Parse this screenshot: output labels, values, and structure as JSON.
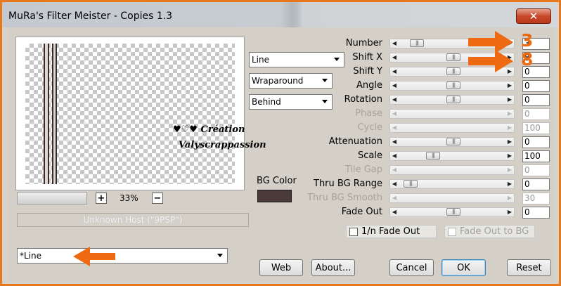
{
  "window": {
    "title": "MuRa's Filter Meister - Copies 1.3",
    "close_glyph": "✕"
  },
  "preview": {
    "zoom_value": "33%",
    "zoom_plus": "+",
    "zoom_minus": "−",
    "host_text": "Unknown Host (\"9PSP\")",
    "watermark_line1": "♥♡♥ Création",
    "watermark_line2": "Valyscrappassion"
  },
  "dropdowns": {
    "copy_mode": "Line",
    "edge_mode": "Wraparound",
    "blend_order": "Behind",
    "preset": "*Line"
  },
  "bg_color": {
    "label": "BG Color",
    "value": "#4a3b38"
  },
  "params": [
    {
      "label": "Number",
      "value": "3",
      "enabled": true,
      "level": 0.12
    },
    {
      "label": "Shift X",
      "value": "8",
      "enabled": true,
      "level": 0.5
    },
    {
      "label": "Shift Y",
      "value": "0",
      "enabled": true,
      "level": 0.5
    },
    {
      "label": "Angle",
      "value": "0",
      "enabled": true,
      "level": 0.5
    },
    {
      "label": "Rotation",
      "value": "0",
      "enabled": true,
      "level": 0.5
    },
    {
      "label": "Phase",
      "value": "0",
      "enabled": false,
      "level": 0
    },
    {
      "label": "Cycle",
      "value": "100",
      "enabled": false,
      "level": 0
    },
    {
      "label": "Attenuation",
      "value": "0",
      "enabled": true,
      "level": 0.5
    },
    {
      "label": "Scale",
      "value": "100",
      "enabled": true,
      "level": 0.29
    },
    {
      "label": "Tile Gap",
      "value": "0",
      "enabled": false,
      "level": 0
    },
    {
      "label": "Thru BG Range",
      "value": "0",
      "enabled": true,
      "level": 0.05
    },
    {
      "label": "Thru BG Smooth",
      "value": "30",
      "enabled": false,
      "level": 0
    },
    {
      "label": "Fade Out",
      "value": "0",
      "enabled": true,
      "level": 0.5
    }
  ],
  "checkboxes": {
    "inv_fade_out": {
      "label": "1/n Fade Out",
      "checked": false
    },
    "fade_out_to_bg": {
      "label": "Fade Out to BG",
      "checked": false
    }
  },
  "buttons": {
    "web": "Web",
    "about": "About...",
    "cancel": "Cancel",
    "ok": "OK",
    "reset": "Reset"
  },
  "annotation": {
    "color": "#ee6a12",
    "number_label": "3",
    "shiftx_label": "8"
  },
  "colors": {
    "accent": "#e8781c",
    "dialog_bg": "#d4d0c8",
    "disabled_text": "#a7a39c"
  }
}
